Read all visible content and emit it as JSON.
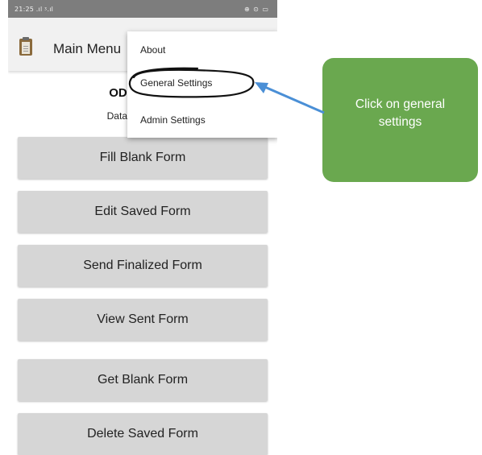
{
  "status_bar": {
    "time": "21:25 .ıl ᶾ.ıl",
    "right_icons": "⊕ ⊙ ▭"
  },
  "action_bar": {
    "title": "Main Menu",
    "icon": "clipboard-icon"
  },
  "header": {
    "app_name": "ODK Co",
    "subtitle": "Data collect"
  },
  "menu_buttons": [
    "Fill Blank Form",
    "Edit Saved Form",
    "Send Finalized Form",
    "View Sent Form",
    "Get Blank Form",
    "Delete Saved Form"
  ],
  "dropdown": {
    "items": [
      "About",
      "General Settings",
      "Admin Settings"
    ]
  },
  "annotation": {
    "text": "Click on general settings",
    "box_color": "#6aa84f",
    "arrow_color": "#4a8fd6"
  }
}
